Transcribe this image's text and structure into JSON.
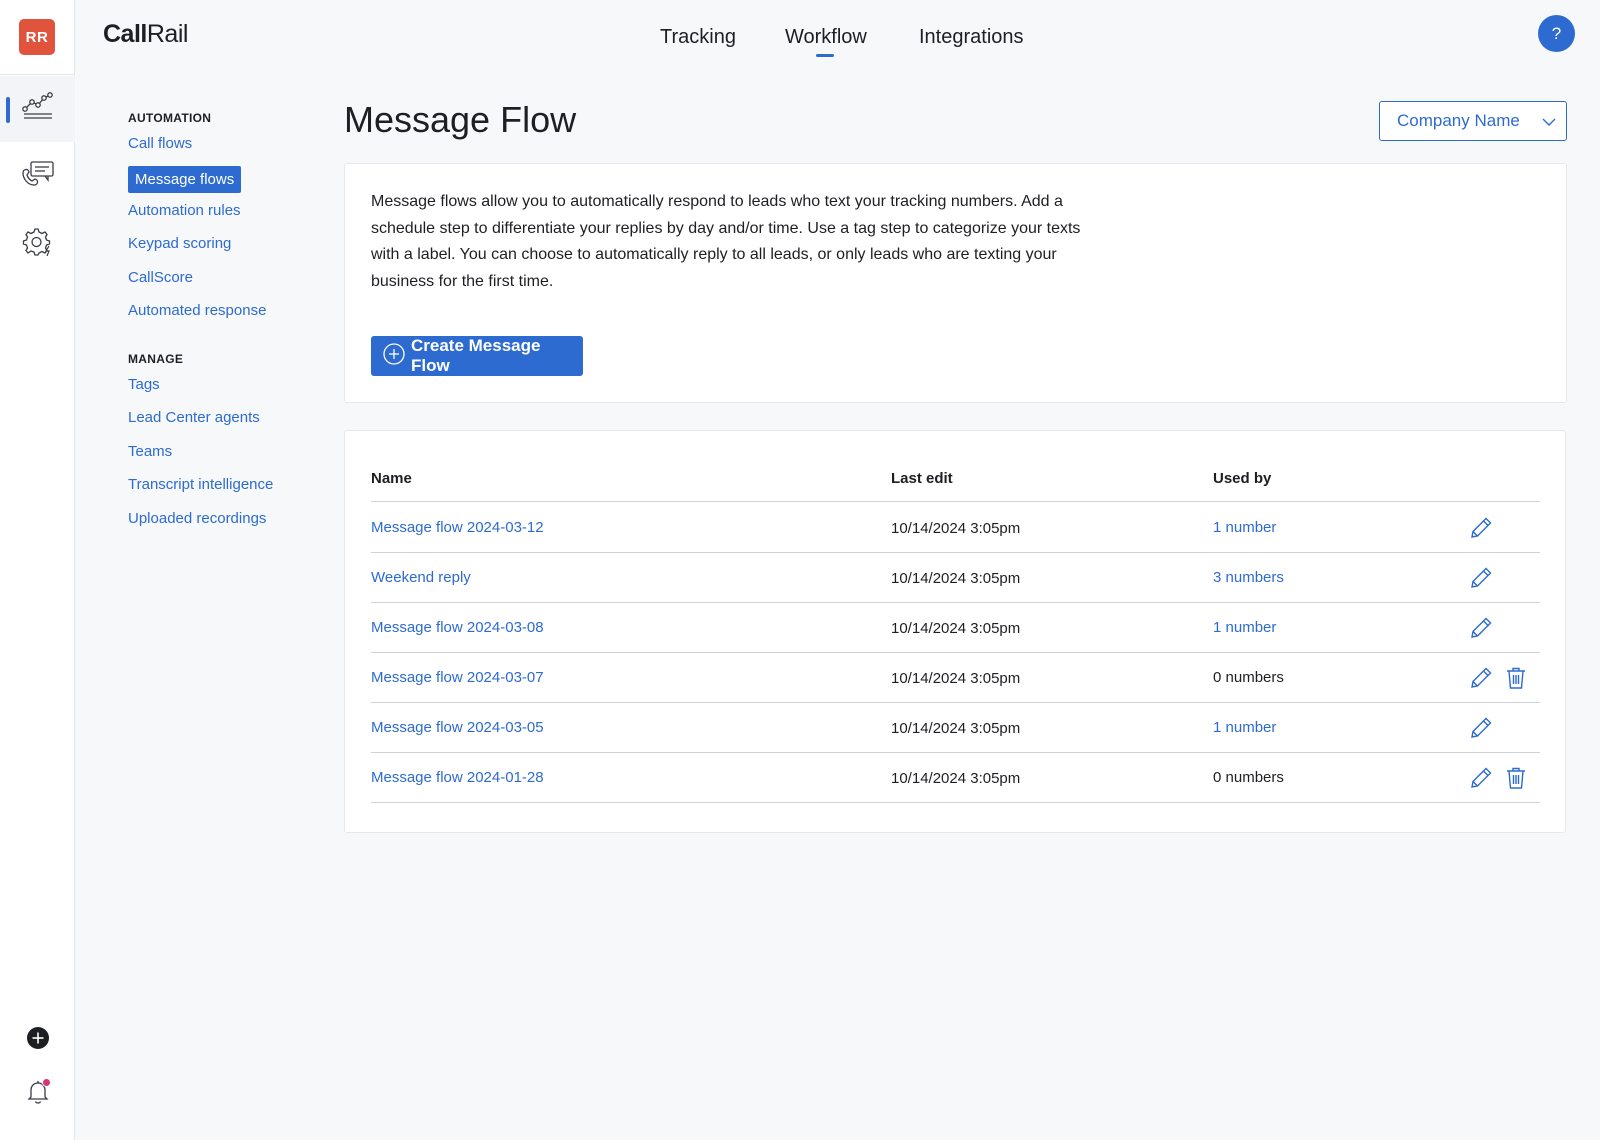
{
  "theme": {
    "accent": "#2d6bd0",
    "link": "#2d6bd0",
    "avatar_bg": "#e0533d",
    "text": "#1d1f23",
    "notification_dot": "#d4367a"
  },
  "rail": {
    "avatar_initials": "RR",
    "items": [
      {
        "icon": "analytics-chart-icon",
        "active": true
      },
      {
        "icon": "conversations-icon",
        "active": false
      },
      {
        "icon": "automation-gear-icon",
        "active": false
      }
    ],
    "bottom": [
      {
        "icon": "add-circle-icon"
      },
      {
        "icon": "notification-bell-icon",
        "has_dot": true
      }
    ]
  },
  "header": {
    "logo_bold": "Call",
    "logo_light": "Rail",
    "nav": [
      {
        "label": "Tracking",
        "active": false
      },
      {
        "label": "Workflow",
        "active": true
      },
      {
        "label": "Integrations",
        "active": false
      }
    ],
    "help_label": "?"
  },
  "sidebar": {
    "automation_heading": "AUTOMATION",
    "automation_items": [
      {
        "label": "Call flows",
        "selected": false
      },
      {
        "label": "Message flows",
        "selected": true
      },
      {
        "label": "Automation rules",
        "selected": false
      },
      {
        "label": "Keypad scoring",
        "selected": false
      },
      {
        "label": "CallScore",
        "selected": false
      },
      {
        "label": "Automated response",
        "selected": false
      }
    ],
    "manage_heading": "MANAGE",
    "manage_items": [
      {
        "label": "Tags"
      },
      {
        "label": "Lead Center agents"
      },
      {
        "label": "Teams"
      },
      {
        "label": "Transcript intelligence"
      },
      {
        "label": "Uploaded recordings"
      }
    ]
  },
  "main": {
    "title": "Message Flow",
    "company_select": "Company Name",
    "description": "Message flows allow you to automatically respond to leads who text your tracking numbers. Add a schedule step to differentiate your replies by day and/or time. Use a tag step to categorize your texts with a label. You can choose to automatically reply to all leads, or only leads who are texting your business for the first time.",
    "create_button": "Create Message Flow",
    "table": {
      "columns": [
        "Name",
        "Last edit",
        "Used by"
      ],
      "rows": [
        {
          "name": "Message flow 2024-03-12",
          "last_edit": "10/14/2024 3:05pm",
          "used_by": "1 number",
          "used_link": true,
          "can_delete": false
        },
        {
          "name": "Weekend reply",
          "last_edit": "10/14/2024 3:05pm",
          "used_by": "3 numbers",
          "used_link": true,
          "can_delete": false
        },
        {
          "name": "Message flow 2024-03-08",
          "last_edit": "10/14/2024 3:05pm",
          "used_by": "1 number",
          "used_link": true,
          "can_delete": false
        },
        {
          "name": "Message flow 2024-03-07",
          "last_edit": "10/14/2024 3:05pm",
          "used_by": "0 numbers",
          "used_link": false,
          "can_delete": true
        },
        {
          "name": "Message flow 2024-03-05",
          "last_edit": "10/14/2024 3:05pm",
          "used_by": "1 number",
          "used_link": true,
          "can_delete": false
        },
        {
          "name": "Message flow 2024-01-28",
          "last_edit": "10/14/2024 3:05pm",
          "used_by": "0 numbers",
          "used_link": false,
          "can_delete": true
        }
      ]
    }
  }
}
